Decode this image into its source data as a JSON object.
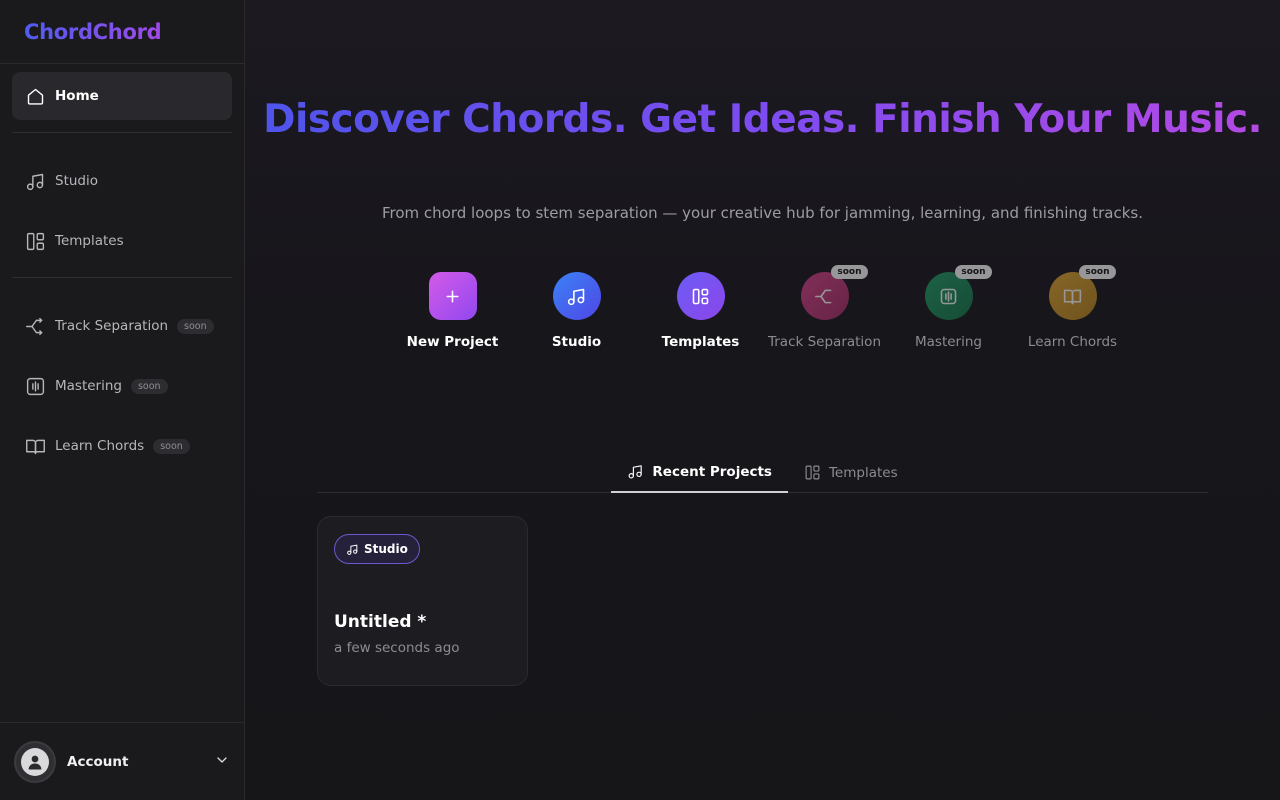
{
  "brand": {
    "name": "ChordChord"
  },
  "sidebar": {
    "items": [
      {
        "label": "Home",
        "icon": "home-icon",
        "active": true
      },
      {
        "label": "Studio",
        "icon": "music-note-icon"
      },
      {
        "label": "Templates",
        "icon": "templates-icon"
      },
      {
        "label": "Track Separation",
        "icon": "split-icon",
        "badge": "soon"
      },
      {
        "label": "Mastering",
        "icon": "waveform-icon",
        "badge": "soon"
      },
      {
        "label": "Learn Chords",
        "icon": "book-icon",
        "badge": "soon"
      }
    ],
    "account_label": "Account"
  },
  "hero": {
    "title": "Discover Chords. Get Ideas. Finish Your Music.",
    "subtitle": "From chord loops to stem separation — your creative hub for jamming, learning, and finishing tracks."
  },
  "actions": [
    {
      "label": "New Project",
      "icon": "plus-icon",
      "color": "#c04fe8"
    },
    {
      "label": "Studio",
      "icon": "music-note-icon",
      "color": "#3b6cf0"
    },
    {
      "label": "Templates",
      "icon": "templates-icon",
      "color": "#7a4cf2"
    },
    {
      "label": "Track Separation",
      "icon": "split-icon",
      "badge": "soon",
      "color": "#c33a7a"
    },
    {
      "label": "Mastering",
      "icon": "waveform-icon",
      "badge": "soon",
      "color": "#1f8a5a"
    },
    {
      "label": "Learn Chords",
      "icon": "book-icon",
      "badge": "soon",
      "color": "#c7942a"
    }
  ],
  "tabs": [
    {
      "label": "Recent Projects",
      "icon": "music-note-icon",
      "active": true
    },
    {
      "label": "Templates",
      "icon": "templates-icon"
    }
  ],
  "projects": [
    {
      "tag": "Studio",
      "title": "Untitled *",
      "time": "a few seconds ago"
    }
  ]
}
